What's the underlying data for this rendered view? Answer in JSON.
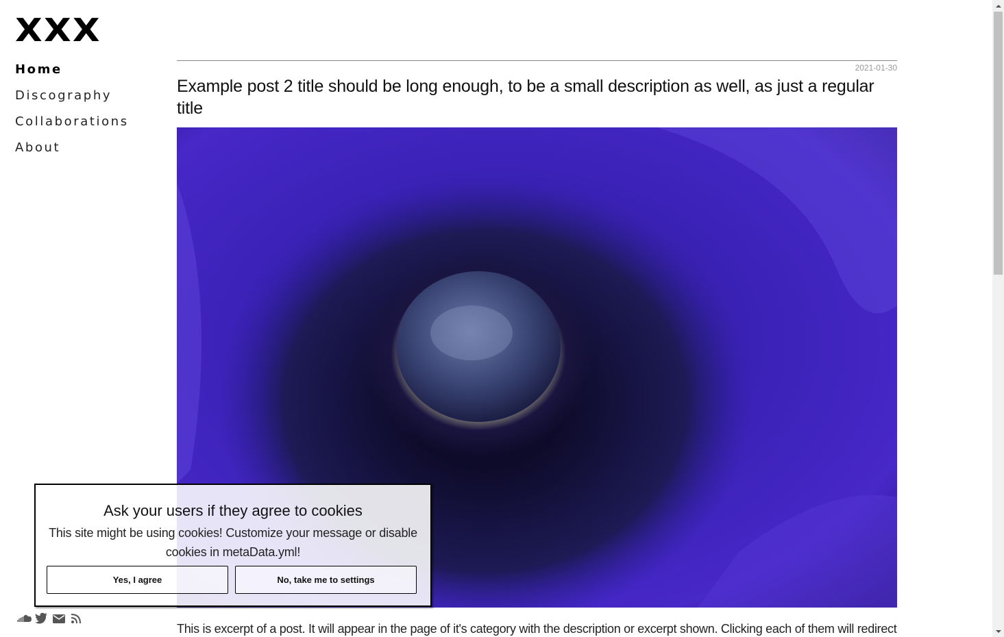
{
  "site": {
    "logo": "XXX"
  },
  "nav": {
    "items": [
      {
        "label": "Home",
        "active": true
      },
      {
        "label": "Discography",
        "active": false
      },
      {
        "label": "Collaborations",
        "active": false
      },
      {
        "label": "About",
        "active": false
      }
    ]
  },
  "social": {
    "icons": [
      "soundcloud-icon",
      "twitter-icon",
      "email-icon",
      "rss-icon"
    ],
    "color": "#555555"
  },
  "post": {
    "date": "2021-01-30",
    "title": "Example post 2 title should be long enough, to be a small description as well, as just a regular title",
    "image_description": "purple anemone flower",
    "excerpt": "This is excerpt of a post. It will appear in the page of it's category with the description or excerpt shown. Clicking each of them will redirect"
  },
  "cookie_banner": {
    "title": "Ask your users if they agree to cookies",
    "body": "This site might be using cookies! Customize your message or disable cookies in metaData.yml!",
    "agree_label": "Yes, I agree",
    "settings_label": "No, take me to settings"
  },
  "colors": {
    "accent": "#000000",
    "flower_purple": "#3d1fa8",
    "date_gray": "#999999"
  }
}
